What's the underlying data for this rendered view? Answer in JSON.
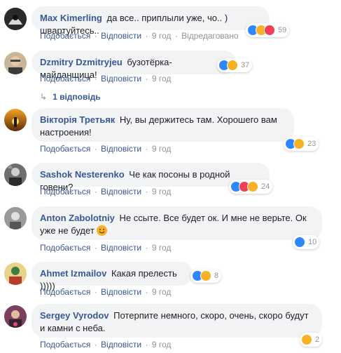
{
  "common": {
    "like": "Подобається",
    "reply": "Відповісти",
    "sep": "·",
    "edited": "Відредаговано"
  },
  "comments": [
    {
      "name": "Max Kimerling",
      "text": "да все.. приплыли уже, чо.. ) швартуйтесь..",
      "time": "9 год",
      "reacts": [
        "like",
        "haha",
        "love"
      ],
      "count": "59"
    },
    {
      "name": "Dzmitry Dzmitryjeu",
      "text": "бузотёрка-майданщица!",
      "time": "9 год",
      "reacts": [
        "like",
        "haha"
      ],
      "count": "37",
      "replies": "1 відповідь"
    },
    {
      "name": "Вікторія Третьяк",
      "text": "Ну, вы держитесь там. Хорошего вам настроения!",
      "time": "9 год",
      "reacts": [
        "like",
        "haha"
      ],
      "count": "23"
    },
    {
      "name": "Sashok Nesterenko",
      "text": "Че как посоны в родной говени?",
      "time": "9 год",
      "reacts": [
        "like",
        "love",
        "haha"
      ],
      "count": "24"
    },
    {
      "name": "Anton Zabolotniy",
      "text": "Не ссыте. Все будет ок. И мне не верьте. Ок уже не будет",
      "time": "9 год",
      "reacts": [
        "like"
      ],
      "count": "10",
      "emoji": "smile-emoji"
    },
    {
      "name": "Ahmet Izmailov",
      "text": "Какая прелесть )))))",
      "time": "9 год",
      "reacts": [
        "like",
        "haha"
      ],
      "count": "8"
    },
    {
      "name": "Sergey Vyrodov",
      "text": "Потерпите немного, скоро, очень, скоро будут и камни с неба.",
      "time": "9 год",
      "reacts": [
        "haha"
      ],
      "count": "2"
    }
  ],
  "colors": {
    "name": "#385898",
    "bubble": "#f2f3f5",
    "meta": "#90949c",
    "like": "#2d88ff",
    "love": "#f33e58",
    "haha": "#f7b125"
  }
}
